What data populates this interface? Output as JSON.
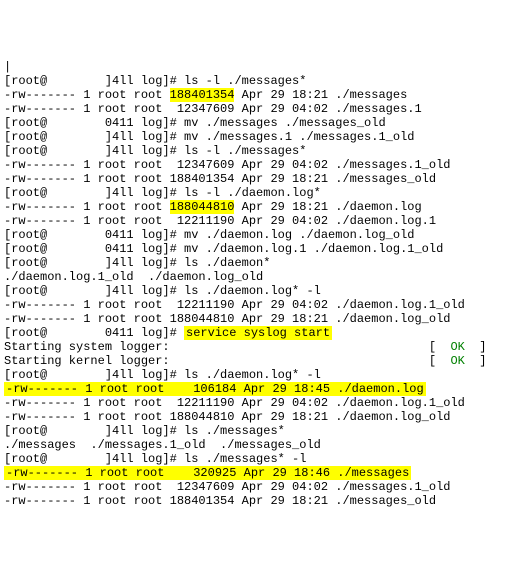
{
  "lines": [
    {
      "segs": [
        {
          "t": "|"
        }
      ]
    },
    {
      "segs": [
        {
          "t": "[root@        ]4ll log]# ls -l ./messages*"
        }
      ]
    },
    {
      "segs": [
        {
          "t": "-rw------- 1 root root "
        },
        {
          "t": "188401354",
          "cls": "hl"
        },
        {
          "t": " Apr 29 18:21 ./messages"
        }
      ]
    },
    {
      "segs": [
        {
          "t": "-rw------- 1 root root  12347609 Apr 29 04:02 ./messages.1"
        }
      ]
    },
    {
      "segs": [
        {
          "t": "[root@        0411 log]# mv ./messages ./messages_old"
        }
      ]
    },
    {
      "segs": [
        {
          "t": "[root@        ]4ll log]# mv ./messages.1 ./messages.1_old"
        }
      ]
    },
    {
      "segs": [
        {
          "t": "[root@        ]4ll log]# ls -l ./messages*"
        }
      ]
    },
    {
      "segs": [
        {
          "t": "-rw------- 1 root root  12347609 Apr 29 04:02 ./messages.1_old"
        }
      ]
    },
    {
      "segs": [
        {
          "t": "-rw------- 1 root root 188401354 Apr 29 18:21 ./messages_old"
        }
      ]
    },
    {
      "segs": [
        {
          "t": "[root@        ]4ll log]# ls -l ./daemon.log*"
        }
      ]
    },
    {
      "segs": [
        {
          "t": "-rw------- 1 root root "
        },
        {
          "t": "188044810",
          "cls": "hl"
        },
        {
          "t": " Apr 29 18:21 ./daemon.log"
        }
      ]
    },
    {
      "segs": [
        {
          "t": "-rw------- 1 root root  12211190 Apr 29 04:02 ./daemon.log.1"
        }
      ]
    },
    {
      "segs": [
        {
          "t": "[root@        0411 log]# mv ./daemon.log ./daemon.log_old"
        }
      ]
    },
    {
      "segs": [
        {
          "t": "[root@        0411 log]# mv ./daemon.log.1 ./daemon.log.1_old"
        }
      ]
    },
    {
      "segs": [
        {
          "t": "[root@        ]4ll log]# ls ./daemon*"
        }
      ]
    },
    {
      "segs": [
        {
          "t": "./daemon.log.1_old  ./daemon.log_old"
        }
      ]
    },
    {
      "segs": [
        {
          "t": "[root@        ]4ll log]# ls ./daemon.log* -l"
        }
      ]
    },
    {
      "segs": [
        {
          "t": "-rw------- 1 root root  12211190 Apr 29 04:02 ./daemon.log.1_old"
        }
      ]
    },
    {
      "segs": [
        {
          "t": "-rw------- 1 root root 188044810 Apr 29 18:21 ./daemon.log_old"
        }
      ]
    },
    {
      "segs": [
        {
          "t": "[root@        0411 log]# "
        },
        {
          "t": "service syslog start",
          "cls": "hlpad"
        }
      ]
    },
    {
      "segs": [
        {
          "t": "Starting system logger:                                    [  "
        },
        {
          "t": "OK",
          "cls": "ok"
        },
        {
          "t": "  ]"
        }
      ]
    },
    {
      "segs": [
        {
          "t": "Starting kernel logger:                                    [  "
        },
        {
          "t": "OK",
          "cls": "ok"
        },
        {
          "t": "  ]"
        }
      ]
    },
    {
      "segs": [
        {
          "t": "[root@        ]4ll log]# ls ./daemon.log* -l"
        }
      ]
    },
    {
      "segs": [
        {
          "t": "-rw------- 1 root root    106184 Apr 29 18:45 ./daemon.log",
          "cls": "hlpad"
        }
      ]
    },
    {
      "segs": [
        {
          "t": "-rw------- 1 root root  12211190 Apr 29 04:02 ./daemon.log.1_old"
        }
      ]
    },
    {
      "segs": [
        {
          "t": "-rw------- 1 root root 188044810 Apr 29 18:21 ./daemon.log_old"
        }
      ]
    },
    {
      "segs": [
        {
          "t": "[root@        ]4ll log]# ls ./messages*"
        }
      ]
    },
    {
      "segs": [
        {
          "t": "./messages  ./messages.1_old  ./messages_old"
        }
      ]
    },
    {
      "segs": [
        {
          "t": "[root@        ]4ll log]# ls ./messages* -l"
        }
      ]
    },
    {
      "segs": [
        {
          "t": "-rw------- 1 root root    320925 Apr 29 18:46 ./messages",
          "cls": "hlpad"
        }
      ]
    },
    {
      "segs": [
        {
          "t": "-rw------- 1 root root  12347609 Apr 29 04:02 ./messages.1_old"
        }
      ]
    },
    {
      "segs": [
        {
          "t": "-rw------- 1 root root 188401354 Apr 29 18:21 ./messages_old"
        }
      ]
    }
  ]
}
